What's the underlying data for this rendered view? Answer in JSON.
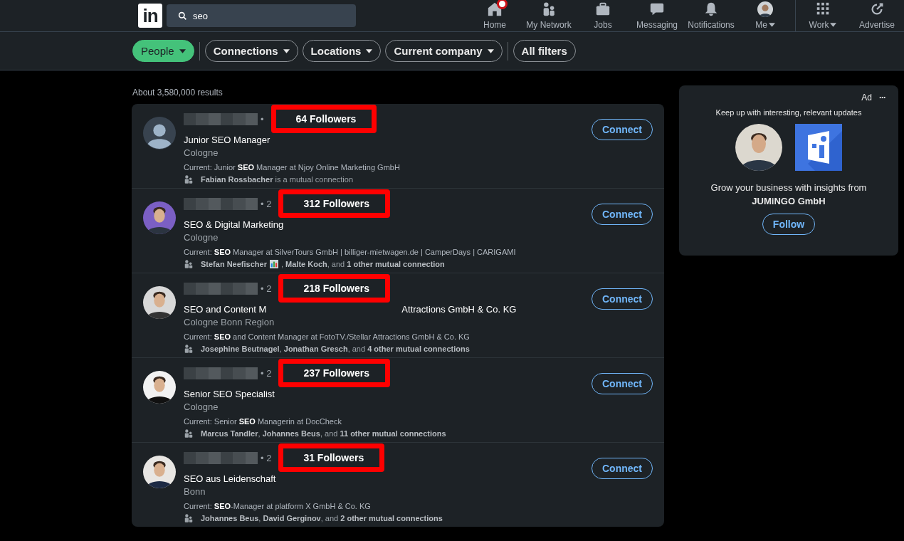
{
  "nav": {
    "logo": "in",
    "search": {
      "value": "seo"
    },
    "items": [
      {
        "label": "Home",
        "badge": true,
        "caret": false,
        "divider_before": false
      },
      {
        "label": "My Network",
        "badge": false,
        "caret": false,
        "divider_before": false
      },
      {
        "label": "Jobs",
        "badge": false,
        "caret": false,
        "divider_before": false
      },
      {
        "label": "Messaging",
        "badge": false,
        "caret": false,
        "divider_before": false
      },
      {
        "label": "Notifications",
        "badge": false,
        "caret": false,
        "divider_before": false
      },
      {
        "label": "Me",
        "badge": false,
        "caret": true,
        "divider_before": false
      },
      {
        "label": "Work",
        "badge": false,
        "caret": true,
        "divider_before": true
      },
      {
        "label": "Advertise",
        "badge": false,
        "caret": false,
        "divider_before": false
      }
    ]
  },
  "filter_groups": [
    [
      {
        "label": "People",
        "selected": true,
        "caret": true
      }
    ],
    [
      {
        "label": "Connections",
        "selected": false,
        "caret": true
      },
      {
        "label": "Locations",
        "selected": false,
        "caret": true
      },
      {
        "label": "Current company",
        "selected": false,
        "caret": true
      }
    ],
    [
      {
        "label": "All filters",
        "selected": false,
        "caret": false
      }
    ]
  ],
  "result_count": "About 3,580,000 results",
  "results": [
    {
      "kind": "silhouette",
      "degree": "•",
      "followers": "64 Followers",
      "title": "Junior SEO Manager",
      "location": "Cologne",
      "current": "Current: Junior **SEO** Manager at Njoy Online Marketing GmbH",
      "mutual": [
        "**Fabian Rossbacher** is a mutual connection"
      ],
      "button": "Connect"
    },
    {
      "kind": "picture",
      "degree": "• 2",
      "followers": "312 Followers",
      "title": "SEO & Digital Marketing",
      "location": "Cologne",
      "current": "Current: **SEO** Manager at SilverTours GmbH | billiger-mietwagen.de | CamperDays | CARIGAMI",
      "mutual": [
        "**Stefan Neefischer**",
        ", **Malte Koch**, and **1 other mutual connection**"
      ],
      "button": "Connect"
    },
    {
      "kind": "picture",
      "degree": "• 2",
      "followers": "218 Followers",
      "title": "SEO and Content M",
      "title_tail": "Attractions GmbH & Co. KG",
      "location": "Cologne Bonn Region",
      "current": "Current: **SEO** and Content Manager at FotoTV./Stellar Attractions GmbH & Co. KG",
      "mutual": [
        "**Josephine Beutnagel**, **Jonathan Gresch**, and **4 other mutual connections**"
      ],
      "button": "Connect"
    },
    {
      "kind": "picture",
      "degree": "• 2",
      "followers": "237 Followers",
      "title": "Senior SEO Specialist",
      "location": "Cologne",
      "current": "Current: Senior **SEO** Managerin at DocCheck",
      "mutual": [
        "**Marcus Tandler**, **Johannes Beus**, and **11 other mutual connections**"
      ],
      "button": "Connect"
    },
    {
      "kind": "picture",
      "degree": "• 2",
      "followers": "31 Followers",
      "title": "SEO aus Leidenschaft",
      "location": "Bonn",
      "current": "Current: **SEO**-Manager at platform X GmbH & Co. KG",
      "mutual": [
        "**Johannes Beus**, **David Gerginov**, and **2 other mutual connections**"
      ],
      "button": "Connect"
    }
  ],
  "ad": {
    "label": "Ad",
    "menu": "···",
    "headline": "Keep up with interesting, relevant updates",
    "body": "Grow your business with insights from **JUMiNGO GmbH**",
    "button": "Follow"
  }
}
